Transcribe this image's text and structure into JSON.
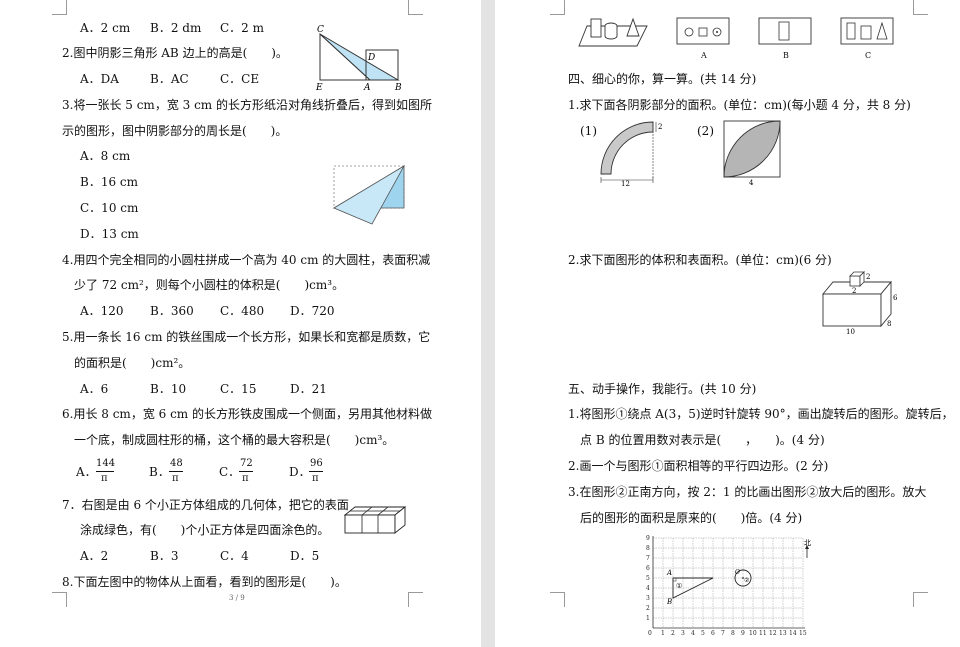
{
  "left": {
    "q1_options": [
      "A．2 cm",
      "B．2 dm",
      "C．2 m"
    ],
    "q2": {
      "stem": "2.图中阴影三角形 AB 边上的高是(　　)。",
      "options": [
        "A．DA",
        "B．AC",
        "C．CE"
      ],
      "labels": [
        "C",
        "D",
        "E",
        "A",
        "B"
      ]
    },
    "q3": {
      "stem_line1": "3.将一张长 5 cm，宽 3 cm 的长方形纸沿对角线折叠后，得到如图所",
      "stem_line2": "示的图形，图中阴影部分的周长是(　　)。",
      "options": [
        "A．8 cm",
        "B．16 cm",
        "C．10 cm",
        "D．13 cm"
      ]
    },
    "q4": {
      "stem_line1": "4.用四个完全相同的小圆柱拼成一个高为 40 cm 的大圆柱，表面积减",
      "stem_line2": "少了 72 cm²，则每个小圆柱的体积是(　　)cm³。",
      "options": [
        "A．120",
        "B．360",
        "C．480",
        "D．720"
      ]
    },
    "q5": {
      "stem_line1": "5.用一条长 16 cm 的铁丝围成一个长方形，如果长和宽都是质数，它",
      "stem_line2": "的面积是(　　)cm²。",
      "options": [
        "A．6",
        "B．10",
        "C．15",
        "D．21"
      ]
    },
    "q6": {
      "stem_line1": "6.用长 8 cm，宽 6 cm 的长方形铁皮围成一个侧面，另用其他材料做",
      "stem_line2": "一个底，制成圆柱形的桶，这个桶的最大容积是(　　)cm³。",
      "options": [
        {
          "letter": "A．",
          "num": "144",
          "den": "π"
        },
        {
          "letter": "B．",
          "num": "48",
          "den": "π"
        },
        {
          "letter": "C．",
          "num": "72",
          "den": "π"
        },
        {
          "letter": "D．",
          "num": "96",
          "den": "π"
        }
      ]
    },
    "q7": {
      "stem_line1": "7．右图是由 6 个小正方体组成的几何体，把它的表面",
      "stem_line2": "涂成绿色，有(　　)个小正方体是四面涂色的。",
      "options": [
        "A．2",
        "B．3",
        "C．4",
        "D．5"
      ]
    },
    "q8": {
      "stem": "8.下面左图中的物体从上面看，看到的图形是(　　)。"
    },
    "page_number": "3 / 9"
  },
  "right": {
    "view_labels": [
      "A",
      "B",
      "C"
    ],
    "section4": {
      "title": "四、细心的你，算一算。(共 14 分)",
      "q1": {
        "stem": "1.求下面各阴影部分的面积。(单位：cm)(每小题 4 分，共 8 分)",
        "fig1_label": "(1)",
        "fig2_label": "(2)",
        "fig1_dims": [
          "2",
          "12"
        ],
        "fig2_dim": "4"
      },
      "q2": {
        "stem": "2.求下面图形的体积和表面积。(单位：cm)(6 分)",
        "dims": [
          "2",
          "2",
          "6",
          "10",
          "8"
        ]
      }
    },
    "section5": {
      "title": "五、动手操作，我能行。(共 10 分)",
      "q1_line1": "1.将图形①绕点 A(3，5)逆时针旋转 90°，画出旋转后的图形。旋转后，",
      "q1_line2": "点 B 的位置用数对表示是(　　，　　)。(4 分)",
      "q2": "2.画一个与图形①面积相等的平行四边形。(2 分)",
      "q3_line1": "3.在图形②正南方向，按 2：1 的比画出图形②放大后的图形。放大",
      "q3_line2": "后的图形的面积是原来的(　　)倍。(4 分)",
      "grid": {
        "north": "北",
        "x_ticks": [
          "0",
          "1",
          "2",
          "3",
          "4",
          "5",
          "6",
          "7",
          "8",
          "9",
          "10",
          "11",
          "12",
          "13",
          "14",
          "15"
        ],
        "y_ticks": [
          "1",
          "2",
          "3",
          "4",
          "5",
          "6",
          "7",
          "8",
          "9"
        ],
        "labels": [
          "A",
          "B",
          "①",
          "O",
          "②"
        ]
      }
    }
  }
}
